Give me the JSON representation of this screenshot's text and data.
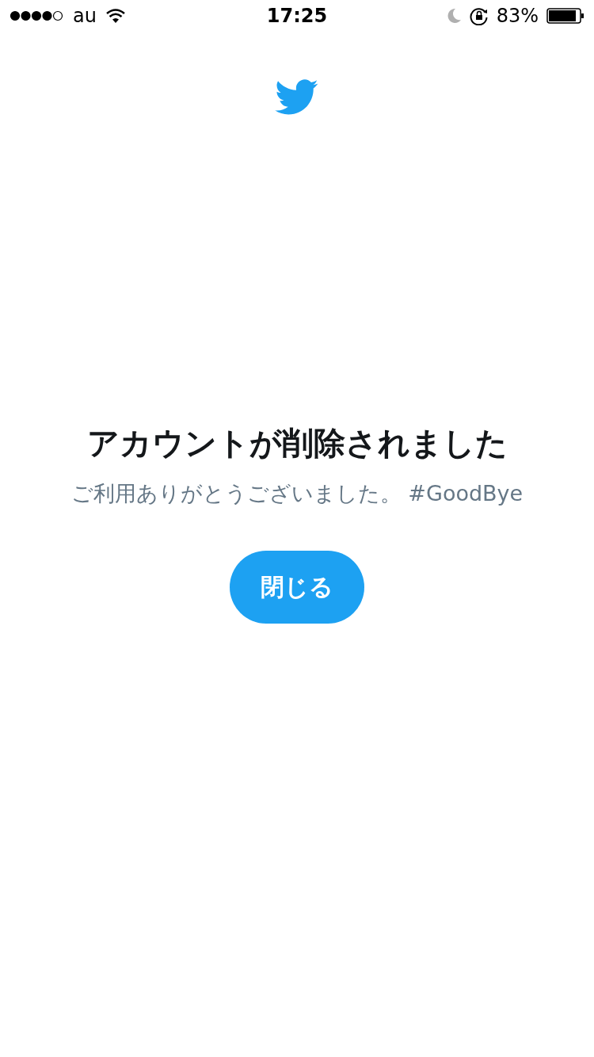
{
  "status_bar": {
    "carrier": "au",
    "time": "17:25",
    "battery": "83%"
  },
  "title": "アカウントが削除されました",
  "message": "ご利用ありがとうございました。 #GoodBye",
  "close_button": {
    "label": "閉じる"
  }
}
